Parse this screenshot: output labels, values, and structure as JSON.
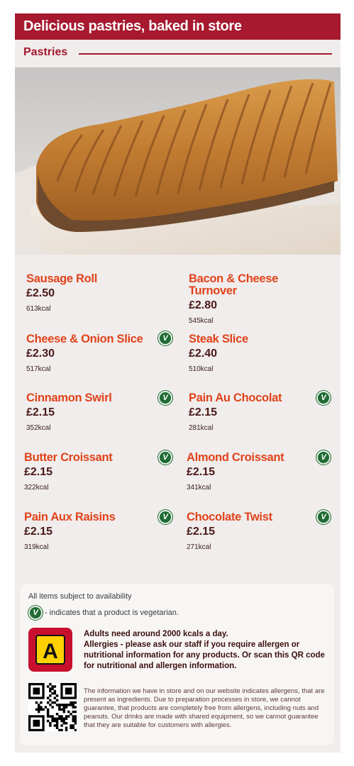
{
  "banner": {
    "title": "Delicious pastries, baked in store"
  },
  "section": {
    "title": "Pastries"
  },
  "items": [
    {
      "name": "Sausage Roll",
      "price": "£2.50",
      "kcal": "613kcal",
      "vegetarian": false
    },
    {
      "name": "Bacon & Cheese Turnover",
      "price": "£2.80",
      "kcal": "545kcal",
      "vegetarian": false
    },
    {
      "name": "Cheese & Onion Slice",
      "price": "£2.30",
      "kcal": "517kcal",
      "vegetarian": true
    },
    {
      "name": "Steak Slice",
      "price": "£2.40",
      "kcal": "510kcal",
      "vegetarian": false
    },
    {
      "name": "Cinnamon Swirl",
      "price": "£2.15",
      "kcal": "352kcal",
      "vegetarian": true
    },
    {
      "name": "Pain Au Chocolat",
      "price": "£2.15",
      "kcal": "281kcal",
      "vegetarian": true
    },
    {
      "name": "Butter Croissant",
      "price": "£2.15",
      "kcal": "322kcal",
      "vegetarian": true
    },
    {
      "name": "Almond Croissant",
      "price": "£2.15",
      "kcal": "341kcal",
      "vegetarian": true
    },
    {
      "name": "Pain Aux Raisins",
      "price": "£2.15",
      "kcal": "319kcal",
      "vegetarian": true
    },
    {
      "name": "Chocolate Twist",
      "price": "£2.15",
      "kcal": "271kcal",
      "vegetarian": true
    }
  ],
  "veg_badge_letter": "V",
  "info": {
    "availability": "All items subject to availability",
    "veg_legend": "- indicates that a product is vegetarian.",
    "allergy_badge_letter": "A",
    "kcal_advice": "Adults need around 2000 kcals a day.",
    "allergy_note": "Allergies - please ask our staff if you require allergen or nutritional information for any products. Or scan this QR code for nutritional and allergen information.",
    "legal": "The information we have in store and on our website indicates allergens, that are present as ingredients. Due to preparation processes in store, we cannot guarantee, that products are completely free from allergens, including nuts and peanuts. Our drinks are made with shared equipment, so we cannot guarantee that they are suitable for customers with allergies."
  },
  "colors": {
    "brand_red": "#a6192e",
    "item_orange": "#e1421a",
    "veg_green": "#1f6b33",
    "allergy_red": "#c8102e",
    "allergy_yellow": "#ffd100"
  }
}
